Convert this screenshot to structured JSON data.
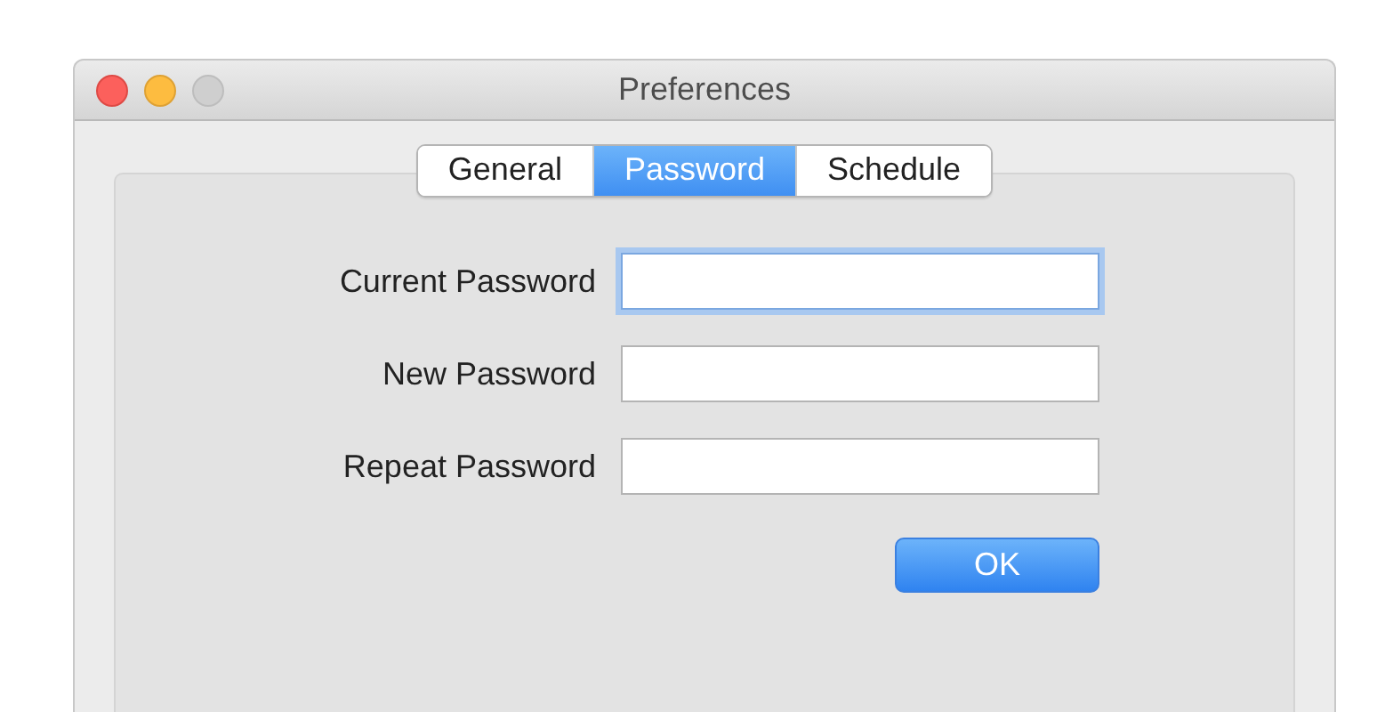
{
  "window": {
    "title": "Preferences",
    "controls": [
      {
        "kind": "close",
        "disabled": false
      },
      {
        "kind": "minimize",
        "disabled": false
      },
      {
        "kind": "zoom",
        "disabled": true
      }
    ]
  },
  "tabs": [
    {
      "label": "General",
      "selected": false
    },
    {
      "label": "Password",
      "selected": true
    },
    {
      "label": "Schedule",
      "selected": false
    }
  ],
  "fields": [
    {
      "label": "Current Password",
      "focused": true
    },
    {
      "label": "New Password",
      "focused": false
    },
    {
      "label": "Repeat Password",
      "focused": false
    }
  ],
  "buttons": [
    {
      "label": "OK",
      "default": true
    }
  ]
}
